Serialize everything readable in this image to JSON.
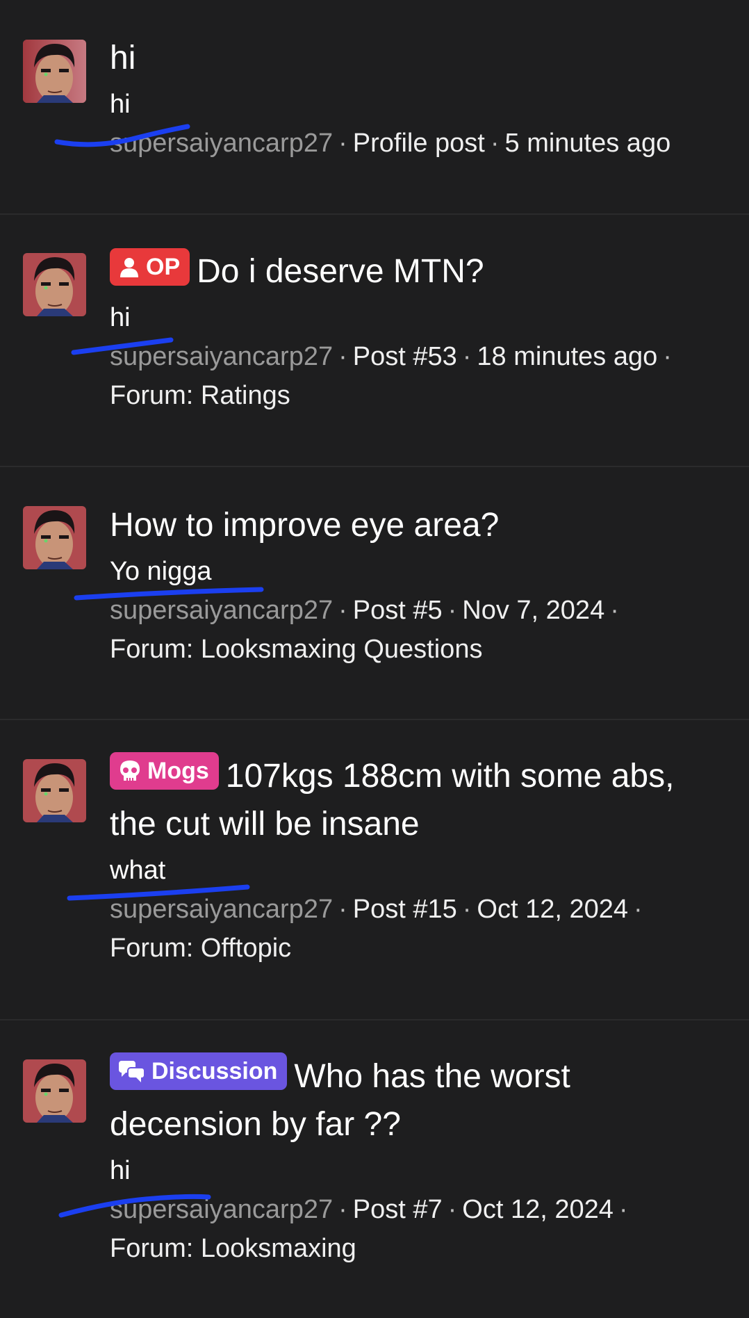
{
  "posts": [
    {
      "title": "hi",
      "badge": null,
      "snippet": "hi",
      "username": "supersaiyancarp27",
      "type": "Profile post",
      "time": "5 minutes ago",
      "forum": null
    },
    {
      "title": "Do i deserve MTN?",
      "badge": {
        "label": "OP",
        "icon": "user-icon",
        "color": "#e8393b"
      },
      "snippet": "hi",
      "username": "supersaiyancarp27",
      "type": "Post #53",
      "time": "18 minutes ago",
      "forum": "Forum: Ratings"
    },
    {
      "title": "How to improve eye area?",
      "badge": null,
      "snippet": "Yo nigga",
      "username": "supersaiyancarp27",
      "type": "Post #5",
      "time": "Nov 7, 2024",
      "forum": "Forum: Looksmaxing Questions"
    },
    {
      "title_line1": "107kgs 188cm with some abs,",
      "title_line2": "the cut will be insane",
      "badge": {
        "label": "Mogs",
        "icon": "skull-icon",
        "color": "#e03c8e"
      },
      "snippet": "what",
      "username": "supersaiyancarp27",
      "type": "Post #15",
      "time": "Oct 12, 2024",
      "forum": "Forum: Offtopic"
    },
    {
      "title_line1": "Who has the worst",
      "title_line2": "decension by far ??",
      "badge": {
        "label": "Discussion",
        "icon": "chat-bubbles-icon",
        "color": "#6a55e0"
      },
      "snippet": "hi",
      "username": "supersaiyancarp27",
      "type": "Post #7",
      "time": "Oct 12, 2024",
      "forum": "Forum: Looksmaxing"
    }
  ],
  "separator": "·",
  "colors": {
    "background": "#1e1e1f",
    "divider": "#2b2b2c",
    "username": "#9a9a9a",
    "scribble": "#1b3ff0"
  }
}
